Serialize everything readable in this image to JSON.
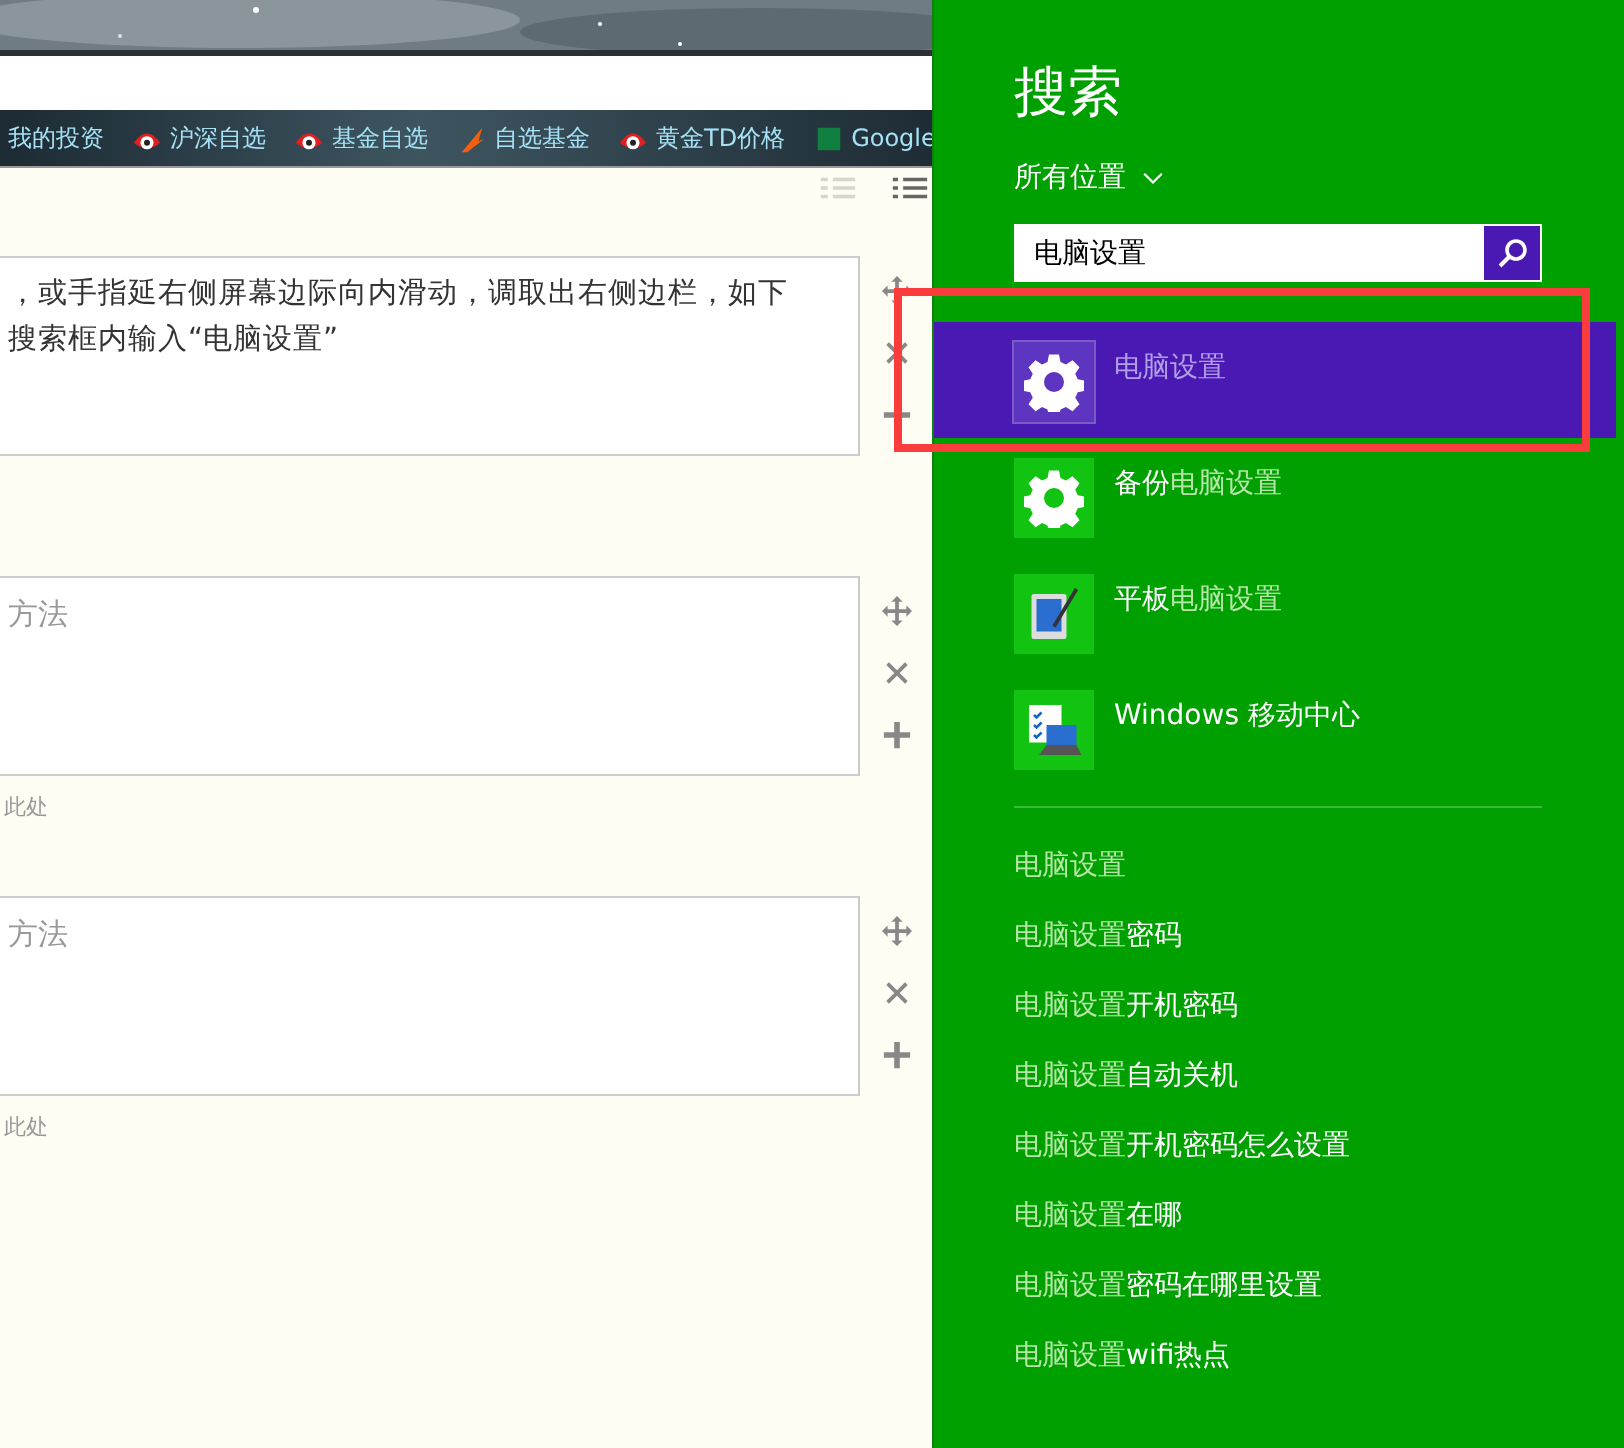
{
  "browser": {
    "bookmarks": [
      {
        "label": "我的投资",
        "kind": "plain"
      },
      {
        "label": "沪深自选",
        "kind": "eye"
      },
      {
        "label": "基金自选",
        "kind": "eye"
      },
      {
        "label": "自选基金",
        "kind": "flame"
      },
      {
        "label": "黄金TD价格",
        "kind": "eye"
      },
      {
        "label": "Google",
        "kind": "square"
      }
    ]
  },
  "editor": {
    "steps": [
      {
        "lines": [
          "，或手指延右侧屏幕边际向内滑动，调取出右侧边栏，如下",
          "搜索框内输入“电脑设置”"
        ],
        "placeholder": false
      },
      {
        "lines": [
          "方法"
        ],
        "placeholder": true,
        "note": "此处"
      },
      {
        "lines": [
          "方法"
        ],
        "placeholder": true,
        "note": "此处"
      }
    ]
  },
  "search_pane": {
    "title": "搜索",
    "scope": "所有位置",
    "query": "电脑设置",
    "apps": [
      {
        "kind": "gear",
        "match": "电脑设置",
        "selected": true
      },
      {
        "kind": "gear",
        "before": "备份",
        "match": "电脑设置",
        "selected": false
      },
      {
        "kind": "tablet",
        "before": "平板",
        "match": "电脑设置",
        "selected": false
      },
      {
        "kind": "mobility",
        "before": "Windows 移动中心",
        "selected": false
      }
    ],
    "suggestions": [
      {
        "match": "电脑设置"
      },
      {
        "match": "电脑设置",
        "rest": "密码"
      },
      {
        "match": "电脑设置",
        "rest": "开机密码"
      },
      {
        "match": "电脑设置",
        "rest": "自动关机"
      },
      {
        "match": "电脑设置",
        "rest": "开机密码怎么设置"
      },
      {
        "match": "电脑设置",
        "rest": "在哪"
      },
      {
        "match": "电脑设置",
        "rest": "密码在哪里设置"
      },
      {
        "match": "电脑设置",
        "rest": "wifi热点"
      }
    ]
  }
}
